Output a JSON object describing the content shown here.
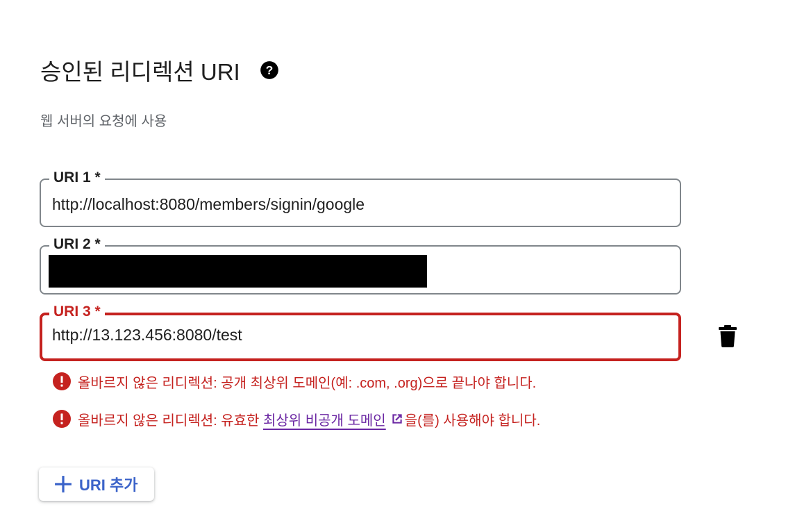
{
  "header": {
    "title": "승인된 리디렉션 URI",
    "help_icon": "help-circle-icon",
    "subtitle": "웹 서버의 요청에 사용"
  },
  "uris": [
    {
      "label": "URI 1 *",
      "value": "http://localhost:8080/members/signin/google",
      "state": "normal"
    },
    {
      "label": "URI 2 *",
      "value": "",
      "state": "redacted"
    },
    {
      "label": "URI 3 *",
      "value": "http://13.123.456:8080/test",
      "state": "error"
    }
  ],
  "delete_icon": "trash-icon",
  "errors": {
    "first": "올바르지 않은 리디렉션: 공개 최상위 도메인(예: .com, .org)으로 끝나야 합니다.",
    "second_prefix": "올바르지 않은 리디렉션: 유효한 ",
    "second_link": "최상위 비공개 도메인",
    "second_suffix": "을(를) 사용해야 합니다."
  },
  "add_button": {
    "label": "URI 추가",
    "icon": "plus-icon"
  },
  "colors": {
    "error": "#c5221f",
    "link": "#6b27a3",
    "accent": "#3b63c9",
    "border": "#80868b"
  }
}
